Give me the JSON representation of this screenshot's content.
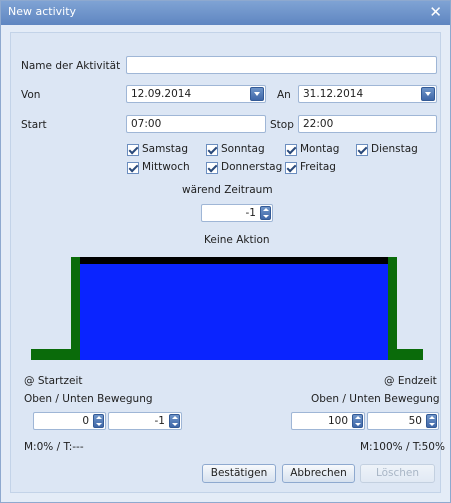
{
  "window": {
    "title": "New activity",
    "close_glyph": "✕"
  },
  "form": {
    "name_label": "Name der Aktivität",
    "name_value": "",
    "von_label": "Von",
    "von_value": "12.09.2014",
    "an_label": "An",
    "an_value": "31.12.2014",
    "start_label": "Start",
    "start_value": "07:00",
    "stop_label": "Stop",
    "stop_value": "22:00"
  },
  "days": [
    {
      "label": "Samstag",
      "checked": true
    },
    {
      "label": "Sonntag",
      "checked": true
    },
    {
      "label": "Montag",
      "checked": true
    },
    {
      "label": "Dienstag",
      "checked": true
    },
    {
      "label": "Mittwoch",
      "checked": true
    },
    {
      "label": "Donnerstag",
      "checked": true
    },
    {
      "label": "Freitag",
      "checked": true
    }
  ],
  "period": {
    "label": "wärend Zeitraum",
    "value": "-1",
    "action_label": "Keine Aktion"
  },
  "timeline": {
    "level_during_percent": 100,
    "level_outside_percent": 0,
    "colors": {
      "fill": "#0a24ff",
      "edge": "#0a6b0a",
      "top": "#000000"
    }
  },
  "start_section": {
    "label": "@ Startzeit",
    "movement_label": "Oben / Unten Bewegung",
    "value1": "0",
    "value2": "-1",
    "status": "M:0% / T:---"
  },
  "end_section": {
    "label": "@ Endzeit",
    "movement_label": "Oben / Unten Bewegung",
    "value1": "100",
    "value2": "50",
    "status": "M:100% / T:50%"
  },
  "buttons": {
    "confirm": "Bestätigen",
    "cancel": "Abbrechen",
    "delete": "Löschen"
  }
}
